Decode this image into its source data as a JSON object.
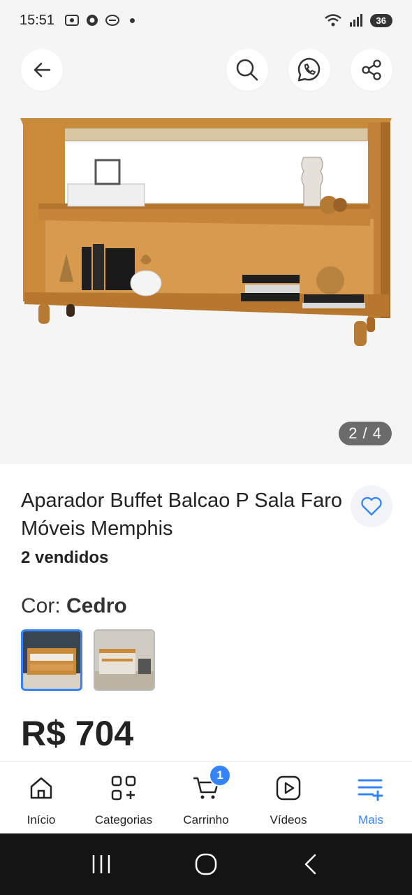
{
  "status_bar": {
    "time": "15:51",
    "battery": "36"
  },
  "gallery": {
    "counter": "2 / 4"
  },
  "product": {
    "title": "Aparador Buffet Balcao P Sala Faro Móveis Memphis",
    "sold": "2 vendidos",
    "color_label": "Cor: ",
    "color_value": "Cedro",
    "price": "R$ 704"
  },
  "bottom_nav": {
    "items": [
      {
        "label": "Início",
        "icon": "home-icon"
      },
      {
        "label": "Categorias",
        "icon": "categories-icon"
      },
      {
        "label": "Carrinho",
        "icon": "cart-icon"
      },
      {
        "label": "Vídeos",
        "icon": "video-icon"
      },
      {
        "label": "Mais",
        "icon": "menu-plus-icon"
      }
    ],
    "cart_count": "1",
    "active_color": "#3483fa"
  }
}
